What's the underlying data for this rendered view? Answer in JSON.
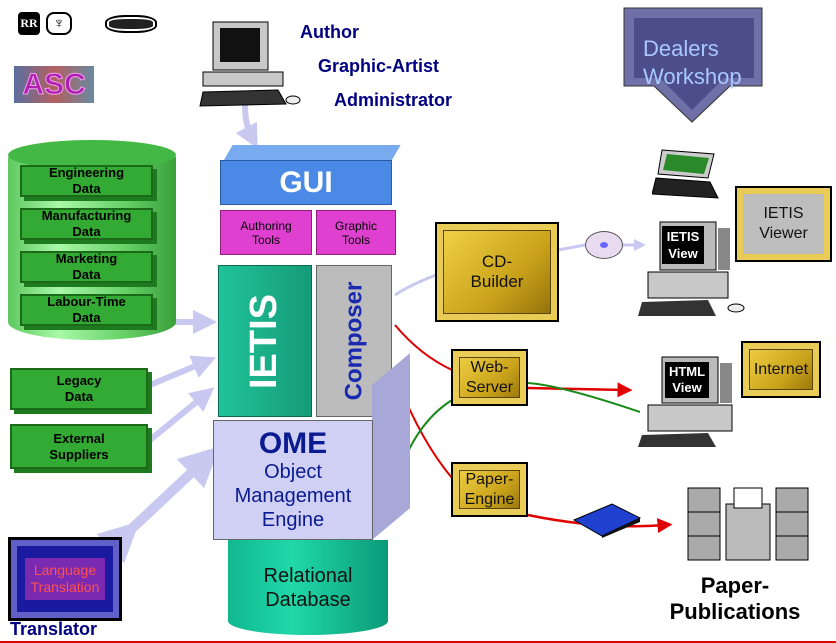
{
  "logos": {
    "rr_badge": "RR",
    "asc": "ASC"
  },
  "roles": [
    "Author",
    "Graphic-Artist",
    "Administrator"
  ],
  "dealers_workshop": [
    "Dealers",
    "Workshop"
  ],
  "data_sources": [
    {
      "line1": "Engineering",
      "line2": "Data"
    },
    {
      "line1": "Manufacturing",
      "line2": "Data"
    },
    {
      "line1": "Marketing",
      "line2": "Data"
    },
    {
      "line1": "Labour-Time",
      "line2": "Data"
    }
  ],
  "legacy": {
    "line1": "Legacy",
    "line2": "Data"
  },
  "external": {
    "line1": "External",
    "line2": "Suppliers"
  },
  "gui": "GUI",
  "authoring_tools": {
    "line1": "Authoring",
    "line2": "Tools"
  },
  "graphic_tools": {
    "line1": "Graphic",
    "line2": "Tools"
  },
  "ietis": "IETIS",
  "composer": "Composer",
  "ome": {
    "title": "OME",
    "line1": "Object",
    "line2": "Management",
    "line3": "Engine"
  },
  "database": {
    "line1": "Relational",
    "line2": "Database"
  },
  "cd_builder": {
    "line1": "CD-",
    "line2": "Builder"
  },
  "web_server": {
    "line1": "Web-",
    "line2": "Server"
  },
  "paper_engine": {
    "line1": "Paper-",
    "line2": "Engine"
  },
  "ietis_viewer": {
    "line1": "IETIS",
    "line2": "Viewer"
  },
  "internet": "Internet",
  "ietis_view_screen": {
    "line1": "IETIS",
    "line2": "View"
  },
  "html_view_screen": {
    "line1": "HTML",
    "line2": "View"
  },
  "paper_publications": {
    "line1": "Paper-",
    "line2": "Publications"
  },
  "language_translation": {
    "line1": "Language",
    "line2": "Translation"
  },
  "translator": "Translator",
  "colors": {
    "arrow_light": "#c8c8f0",
    "red": "#e00000",
    "green": "#1a8a1a",
    "navy": "#000080",
    "gui": "#4a8ae6",
    "magenta": "#e040d0",
    "ietis": "#1fc39a",
    "ome": "#d0d0f4"
  }
}
